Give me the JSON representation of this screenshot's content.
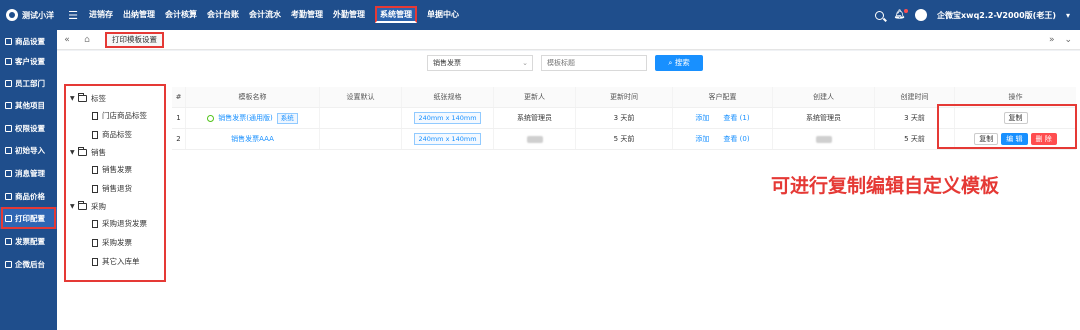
{
  "app": {
    "brand": "测试小洋"
  },
  "nav": [
    {
      "label": "进销存"
    },
    {
      "label": "出纳管理"
    },
    {
      "label": "会计核算"
    },
    {
      "label": "会计台账"
    },
    {
      "label": "会计流水"
    },
    {
      "label": "考勤管理"
    },
    {
      "label": "外勤管理"
    },
    {
      "label": "系统管理"
    },
    {
      "label": "单据中心"
    }
  ],
  "user": {
    "label": "企微宝xwq2.2-V2000版(老王)"
  },
  "sidebar": [
    {
      "label": "商品设置"
    },
    {
      "label": "客户设置"
    },
    {
      "label": "员工部门"
    },
    {
      "label": "其他项目"
    },
    {
      "label": "权限设置"
    },
    {
      "label": "初始导入"
    },
    {
      "label": "消息管理"
    },
    {
      "label": "商品价格"
    },
    {
      "label": "打印配置"
    },
    {
      "label": "发票配置"
    },
    {
      "label": "企微后台"
    }
  ],
  "tabs": {
    "active": "打印模板设置"
  },
  "search": {
    "select_value": "销售发票",
    "placeholder": "模板标题",
    "button": "搜索"
  },
  "tree": {
    "groups": [
      {
        "label": "标签",
        "children": [
          "门店商品标签",
          "商品标签"
        ]
      },
      {
        "label": "销售",
        "children": [
          "销售发票",
          "销售退货"
        ]
      },
      {
        "label": "采购",
        "children": [
          "采购退货发票",
          "采购发票",
          "其它入库单"
        ]
      }
    ]
  },
  "table": {
    "headers": {
      "num": "#",
      "name": "模板名称",
      "default": "设置默认",
      "size": "纸张规格",
      "updater": "更新人",
      "updated": "更新时间",
      "config": "客户配置",
      "creator": "创建人",
      "created": "创建时间",
      "ops": "操作"
    },
    "rows": [
      {
        "num": "1",
        "name": "销售发票(通用版)",
        "badge": "系统",
        "size": "240mm x 140mm",
        "updater": "系统管理员",
        "updated": "3 天前",
        "add": "添加",
        "view": "查看 (1)",
        "creator": "系统管理员",
        "created": "3 天前",
        "copy": "复制"
      },
      {
        "num": "2",
        "name": "销售发票AAA",
        "size": "240mm x 140mm",
        "updated": "5 天前",
        "add": "添加",
        "view": "查看 (0)",
        "created": "5 天前",
        "copy": "复制",
        "edit": "编 辑",
        "delete": "删 除"
      }
    ]
  },
  "annotation": "可进行复制编辑自定义模板"
}
